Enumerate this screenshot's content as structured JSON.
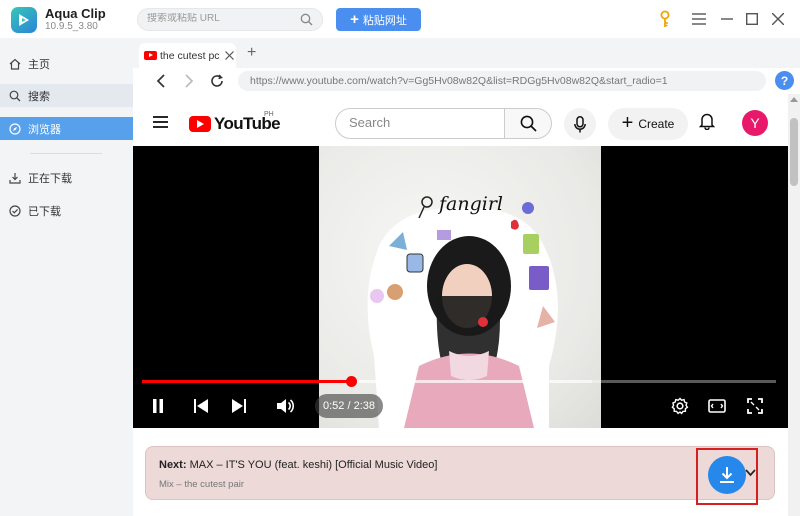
{
  "app": {
    "name": "Aqua Clip",
    "version": "10.9.5_3.80",
    "search_placeholder": "搜索或粘贴 URL",
    "paste_button": "粘贴网址"
  },
  "sidebar": {
    "items": [
      {
        "label": "主页",
        "icon": "home-icon"
      },
      {
        "label": "搜索",
        "icon": "search-icon"
      },
      {
        "label": "浏览器",
        "icon": "compass-icon"
      },
      {
        "label": "正在下载",
        "icon": "download-icon"
      },
      {
        "label": "已下载",
        "icon": "check-circle-icon"
      }
    ],
    "active_index": 2
  },
  "browser": {
    "tab_title": "the cutest pc",
    "url": "https://www.youtube.com/watch?v=Gg5Hv08w82Q&list=RDGg5Hv08w82Q&start_radio=1"
  },
  "youtube": {
    "logo_text": "YouTube",
    "region": "PH",
    "search_placeholder": "Search",
    "create_label": "Create",
    "avatar_letter": "Y",
    "video_art_text": "fangirl",
    "time": "0:52 / 2:38",
    "progress_fraction": 0.33,
    "buffer_fraction": 0.71,
    "next_label": "Next:",
    "next_title": "MAX – IT'S YOU (feat. keshi) [Official Music Video]",
    "next_sub": "Mix – the cutest pair"
  },
  "colors": {
    "accent": "#4a8ff0",
    "sidebar_active": "#57a0ec",
    "yt_red": "#ff0000",
    "highlight_box": "#d61f1f"
  }
}
